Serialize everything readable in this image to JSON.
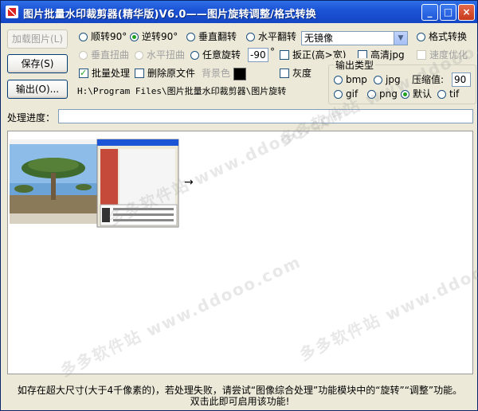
{
  "window": {
    "title": "图片批量水印裁剪器(精华版)V6.0——图片旋转调整/格式转换",
    "min": "_",
    "max": "□",
    "close": "×"
  },
  "buttons": {
    "load": "加载图片(L)",
    "save": "保存(S)",
    "output": "输出(O)..."
  },
  "rotate": {
    "cw90": "顺转90°",
    "ccw90": "逆转90°",
    "vflip": "垂直翻转",
    "hflip": "水平翻转",
    "mirror_select": "无镜像",
    "format_convert": "格式转换",
    "v_skew": "垂直扭曲",
    "h_skew": "水平扭曲",
    "any_rotate": "任意旋转",
    "angle": "-90",
    "angle_unit": "°",
    "straighten": "扳正(高>宽)",
    "hq_jpg": "高清jpg",
    "speed_opt": "速度优化"
  },
  "batch": {
    "batch_process": "批量处理",
    "delete_original": "删除原文件",
    "bg_color_label": "背景色",
    "bg_color": "#000000",
    "grayscale": "灰度"
  },
  "output_type": {
    "legend": "输出类型",
    "bmp": "bmp",
    "jpg": "jpg",
    "compress_label": "压缩值:",
    "compress_value": "90",
    "gif": "gif",
    "png": "png",
    "default": "默认",
    "tif": "tif"
  },
  "path": "H:\\Program Files\\图片批量水印裁剪器\\图片旋转",
  "progress": {
    "label": "处理进度：",
    "value": 0
  },
  "preview": {
    "arrow": "→"
  },
  "watermark": "多多软件站 www.ddooo.com",
  "footer": {
    "line1": "如存在超大尺寸(大于4千像素的)，若处理失败，请尝试“图像综合处理”功能模块中的“旋转”“调整”功能。",
    "line2": "双击此即可启用该功能!"
  },
  "colors": {
    "titlebar": "#1C54D6",
    "face": "#ECE9D8",
    "radio_dot": "#21A121"
  }
}
